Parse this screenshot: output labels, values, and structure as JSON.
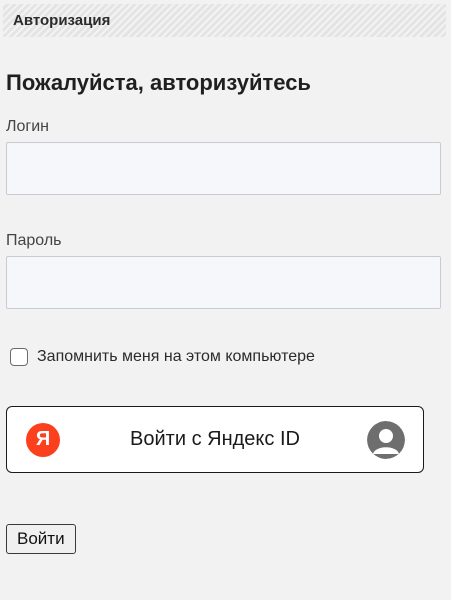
{
  "header": {
    "title": "Авторизация"
  },
  "page": {
    "heading": "Пожалуйста, авторизуйтесь"
  },
  "form": {
    "login": {
      "label": "Логин",
      "value": "",
      "placeholder": ""
    },
    "password": {
      "label": "Пароль",
      "value": "",
      "placeholder": ""
    },
    "remember": {
      "label": "Запомнить меня на этом компьютере",
      "checked": false
    },
    "yandex_button": {
      "label": "Войти с Яндекс ID",
      "logo_letter": "Я",
      "logo_color": "#fc3f1d",
      "avatar_icon": "user-avatar-icon"
    },
    "submit_label": "Войти"
  },
  "colors": {
    "background": "#f2f2f2",
    "input_background": "#f5f7fb",
    "yandex_red": "#fc3f1d",
    "avatar_gray": "#6e6e6e"
  }
}
